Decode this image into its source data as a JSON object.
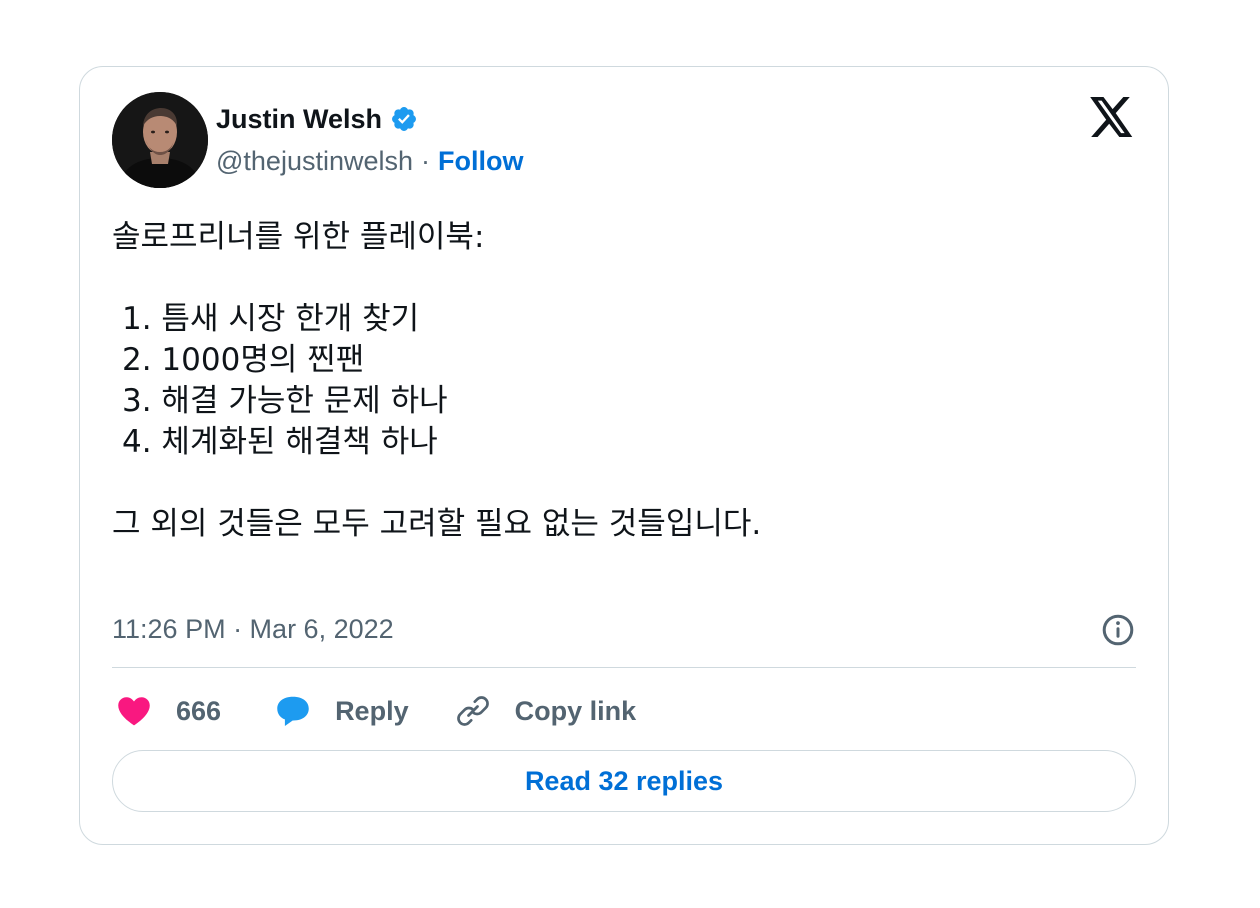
{
  "author": {
    "display_name": "Justin Welsh",
    "handle": "@thejustinwelsh",
    "separator": "·",
    "follow_label": "Follow",
    "verified": true
  },
  "tweet": {
    "lines": [
      "솔로프리너를 위한 플레이북:",
      "",
      "1. 틈새 시장 한개 찾기",
      "2. 1000명의 찐팬",
      "3. 해결 가능한 문제 하나",
      "4. 체계화된 해결책 하나",
      "",
      "그 외의 것들은 모두 고려할 필요 없는 것들입니다."
    ]
  },
  "meta": {
    "timestamp": "11:26 PM · Mar 6, 2022"
  },
  "actions": {
    "like_count": "666",
    "reply_label": "Reply",
    "copy_link_label": "Copy link"
  },
  "footer": {
    "read_replies_label": "Read 32 replies"
  },
  "colors": {
    "accent": "#006fd6",
    "verified": "#1d9bf0",
    "heart": "#f91880",
    "muted": "#536471",
    "border": "#cfd9de"
  },
  "icons": {
    "brand": "x-logo-icon",
    "verified": "verified-badge-icon",
    "info": "info-icon",
    "like": "heart-icon",
    "reply": "speech-bubble-icon",
    "copy": "link-icon"
  }
}
